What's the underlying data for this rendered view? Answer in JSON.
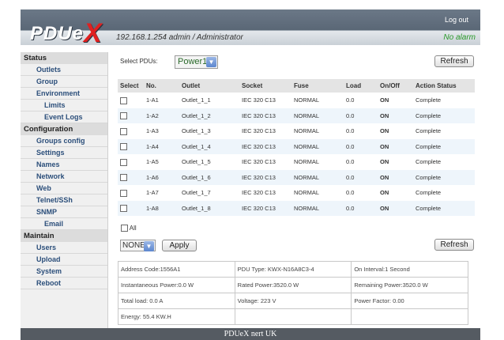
{
  "header": {
    "logo_text": "PDUe",
    "logo_x": "X",
    "logout": "Log out",
    "ip_user": "192.168.1.254   admin / Administrator",
    "alarm": "No alarm"
  },
  "sidebar": {
    "sections": [
      {
        "title": "Status",
        "items": [
          "Outlets",
          "Group",
          "Environment",
          "Limits",
          "Event Logs"
        ]
      },
      {
        "title": "Configuration",
        "items": [
          "Groups config",
          "Settings",
          "Names",
          "Network",
          "Web",
          "Telnet/SSh",
          "SNMP",
          "Email"
        ]
      },
      {
        "title": "Maintain",
        "items": [
          "Users",
          "Upload",
          "System",
          "Reboot"
        ]
      }
    ]
  },
  "controls": {
    "select_label": "Select PDUs:",
    "pdu_value": "Power1",
    "refresh": "Refresh",
    "all_label": "All",
    "action_value": "NONE",
    "apply": "Apply"
  },
  "table": {
    "columns": [
      "Select",
      "No.",
      "Outlet",
      "Socket",
      "Fuse",
      "Load",
      "On/Off",
      "Action Status"
    ],
    "rows": [
      {
        "no": "1-A1",
        "outlet": "Outlet_1_1",
        "socket": "IEC 320 C13",
        "fuse": "NORMAL",
        "load": "0.0",
        "state": "ON",
        "status": "Complete"
      },
      {
        "no": "1-A2",
        "outlet": "Outlet_1_2",
        "socket": "IEC 320 C13",
        "fuse": "NORMAL",
        "load": "0.0",
        "state": "ON",
        "status": "Complete"
      },
      {
        "no": "1-A3",
        "outlet": "Outlet_1_3",
        "socket": "IEC 320 C13",
        "fuse": "NORMAL",
        "load": "0.0",
        "state": "ON",
        "status": "Complete"
      },
      {
        "no": "1-A4",
        "outlet": "Outlet_1_4",
        "socket": "IEC 320 C13",
        "fuse": "NORMAL",
        "load": "0.0",
        "state": "ON",
        "status": "Complete"
      },
      {
        "no": "1-A5",
        "outlet": "Outlet_1_5",
        "socket": "IEC 320 C13",
        "fuse": "NORMAL",
        "load": "0.0",
        "state": "ON",
        "status": "Complete"
      },
      {
        "no": "1-A6",
        "outlet": "Outlet_1_6",
        "socket": "IEC 320 C13",
        "fuse": "NORMAL",
        "load": "0.0",
        "state": "ON",
        "status": "Complete"
      },
      {
        "no": "1-A7",
        "outlet": "Outlet_1_7",
        "socket": "IEC 320 C13",
        "fuse": "NORMAL",
        "load": "0.0",
        "state": "ON",
        "status": "Complete"
      },
      {
        "no": "1-A8",
        "outlet": "Outlet_1_8",
        "socket": "IEC 320 C13",
        "fuse": "NORMAL",
        "load": "0.0",
        "state": "ON",
        "status": "Complete"
      }
    ]
  },
  "info": {
    "rows": [
      [
        "Address Code:1556A1",
        "PDU Type: KWX-N16A8C3-4",
        "On Interval:1 Second"
      ],
      [
        "Instantaneous Power:0.0 W",
        "Rated Power:3520.0 W",
        "Remaining Power:3520.0 W"
      ],
      [
        "Total load: 0.0 A",
        "Voltage: 223 V",
        "Power Factor: 0.00"
      ],
      [
        "Energy: 55.4 KW.H",
        "",
        ""
      ]
    ]
  },
  "footer": "PDUeX nert UK",
  "colors": {
    "header": "#5b6877",
    "on": "#2a9a2a",
    "alarm": "#2a9a2a",
    "logo_x": "#e02020",
    "sidebar_link": "#2b4e7a"
  }
}
